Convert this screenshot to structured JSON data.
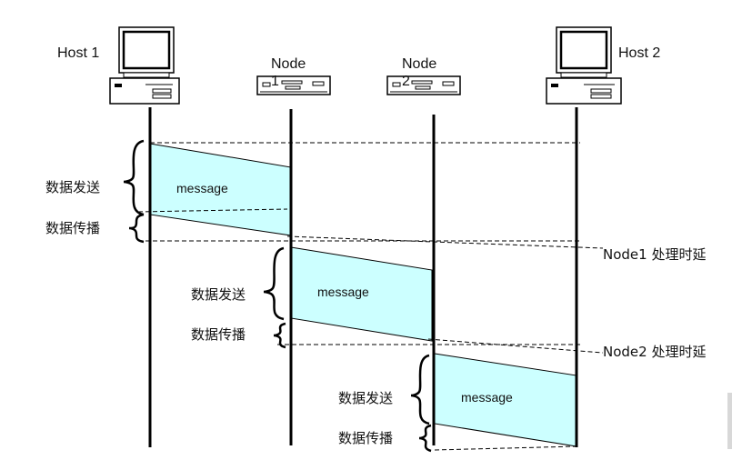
{
  "nodes": {
    "host1": "Host 1",
    "node1_line1": "Node",
    "node1_line2": "1",
    "node2_line1": "Node",
    "node2_line2": "2",
    "host2": "Host 2"
  },
  "messages": [
    "message",
    "message",
    "message"
  ],
  "hop_labels": {
    "send": "数据发送",
    "propagate": "数据传播"
  },
  "delay_labels": {
    "node1": "Node1 处理时延",
    "node2": "Node2 处理时延"
  },
  "colors": {
    "message_fill": "#ccffff",
    "line": "#000000"
  }
}
